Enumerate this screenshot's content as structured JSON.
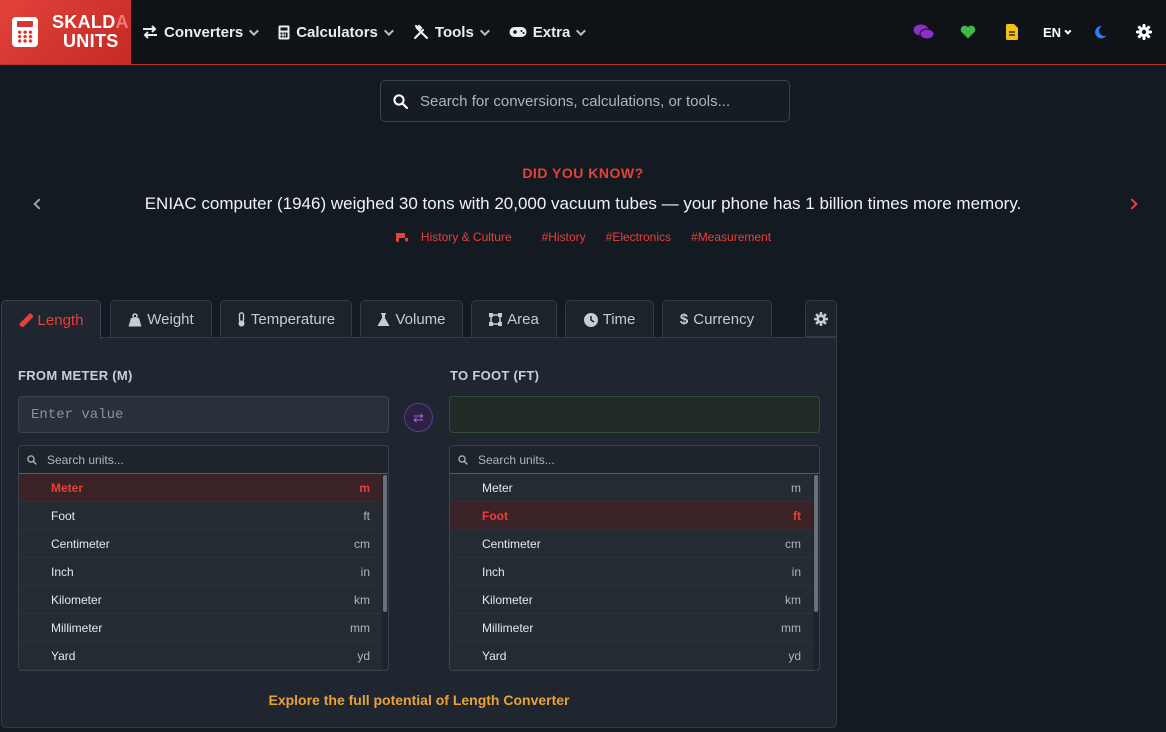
{
  "logo": {
    "line1": "SKALD",
    "line1_fade": "A",
    "line2": "UNITS"
  },
  "nav": [
    {
      "label": "Converters",
      "icon": "arrows-swap-icon"
    },
    {
      "label": "Calculators",
      "icon": "calculator-icon"
    },
    {
      "label": "Tools",
      "icon": "tools-icon"
    },
    {
      "label": "Extra",
      "icon": "gamepad-icon"
    }
  ],
  "header_right": {
    "lang": "EN"
  },
  "colors": {
    "accent": "#e8403a",
    "chat": "#8b2fc9",
    "heart": "#3db84a",
    "doc": "#f2c018",
    "moon": "#2f7cf6"
  },
  "search": {
    "placeholder": "Search for conversions, calculations, or tools..."
  },
  "did_you_know": {
    "title": "DID YOU KNOW?",
    "fact": "ENIAC computer (1946) weighed 30 tons with 20,000 vacuum tubes — your phone has 1 billion times more memory.",
    "tags": [
      "History & Culture",
      "#History",
      "#Electronics",
      "#Measurement"
    ]
  },
  "tabs": [
    "Length",
    "Weight",
    "Temperature",
    "Volume",
    "Area",
    "Time",
    "Currency"
  ],
  "converter": {
    "from_label": "FROM METER (M)",
    "to_label": "TO FOOT (FT)",
    "input_placeholder": "Enter value",
    "unit_search_placeholder": "Search units...",
    "units": [
      {
        "name": "Meter",
        "abbr": "m"
      },
      {
        "name": "Foot",
        "abbr": "ft"
      },
      {
        "name": "Centimeter",
        "abbr": "cm"
      },
      {
        "name": "Inch",
        "abbr": "in"
      },
      {
        "name": "Kilometer",
        "abbr": "km"
      },
      {
        "name": "Millimeter",
        "abbr": "mm"
      },
      {
        "name": "Yard",
        "abbr": "yd"
      }
    ],
    "from_selected": "Meter",
    "to_selected": "Foot",
    "explore": "Explore the full potential of Length Converter"
  }
}
